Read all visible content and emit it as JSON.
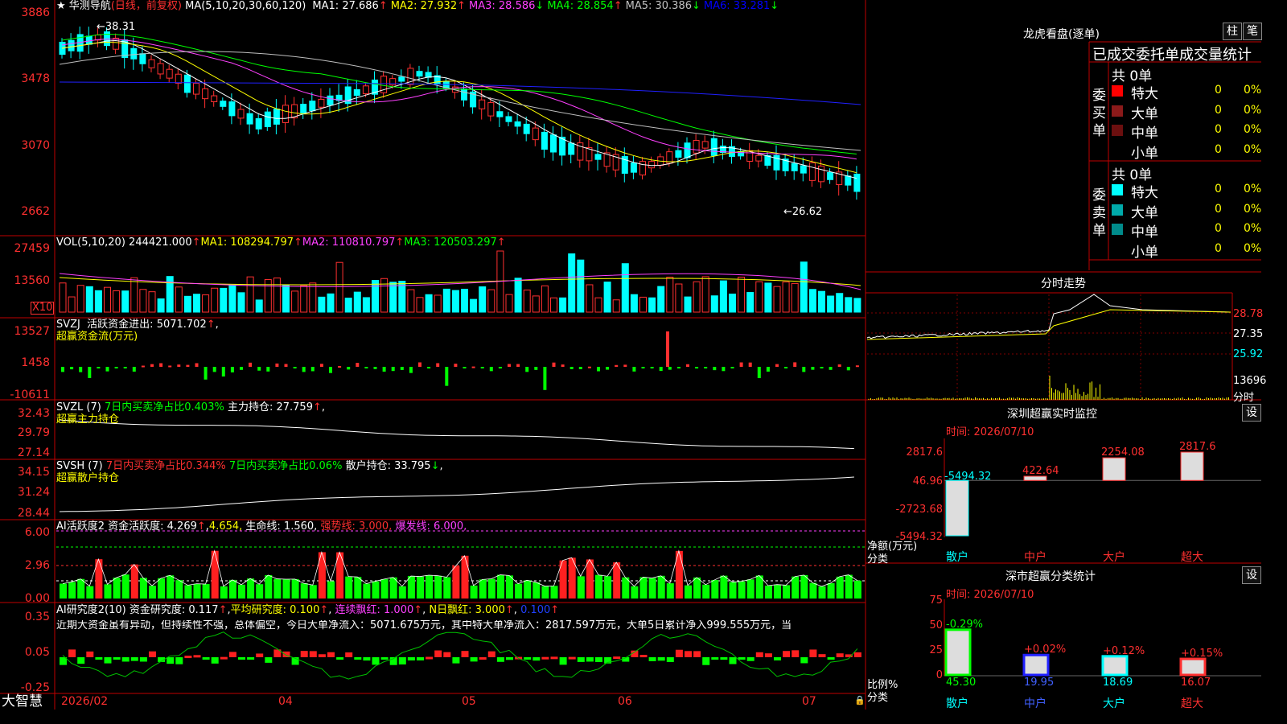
{
  "title": "华测导航",
  "title_suffix": "(日线，前复权)",
  "ma_header": "MA(5,10,20,30,60,120)",
  "ma_values": [
    {
      "label": "MA1:",
      "value": "27.686",
      "arrow": "↑",
      "color": "#ffffff"
    },
    {
      "label": "MA2:",
      "value": "27.932",
      "arrow": "↑",
      "color": "#ffff00"
    },
    {
      "label": "MA3:",
      "value": "28.586",
      "arrow": "↓",
      "color": "#ff40ff"
    },
    {
      "label": "MA4:",
      "value": "28.854",
      "arrow": "↑",
      "color": "#00ff00"
    },
    {
      "label": "MA5:",
      "value": "30.386",
      "arrow": "↓",
      "color": "#c0c0c0"
    },
    {
      "label": "MA6:",
      "value": "33.281",
      "arrow": "↓",
      "color": "#0000ff"
    }
  ],
  "price_axis": [
    "3886",
    "3478",
    "3070",
    "2662"
  ],
  "price_high_label": "38.31",
  "price_low_label": "26.62",
  "vol_header": {
    "name": "VOL(5,10,20)",
    "value": "244421.000",
    "ma1": "MA1: 108294.797",
    "ma2": "MA2: 110810.797",
    "ma3": "MA3: 120503.297"
  },
  "vol_axis": [
    "27459",
    "13560"
  ],
  "vol_unit": "X10",
  "svzj": {
    "name": "SVZJ",
    "label": "活跃资金进出:",
    "value": "5071.702",
    "desc": "超赢资金流(万元)",
    "axis": [
      "13527",
      "1458",
      "-10611"
    ]
  },
  "svzl": {
    "name": "SVZL (7)",
    "t1": "7日内买卖净占比0.403%",
    "t2": "主力持仓: 27.759",
    "desc": "超赢主力持仓",
    "axis": [
      "32.43",
      "29.79",
      "27.14"
    ]
  },
  "svsh": {
    "name": "SVSH (7)",
    "t1": "7日内买卖净占比0.344%",
    "t2": "7日内买卖净占比0.06%",
    "t3": "散户持仓: 33.795",
    "desc": "超赢散户持仓",
    "axis": [
      "34.15",
      "31.24",
      "28.44"
    ]
  },
  "ai1": {
    "name": "AI活跃度2",
    "t1": "资金活跃度: 4.269",
    "t2": "4.654,",
    "t3": "生命线: 1.560,",
    "t4": "强势线: 3.000,",
    "t5": "爆发线: 6.000,",
    "axis": [
      "6.00",
      "2.96",
      "0.00"
    ]
  },
  "ai2": {
    "name": "AI研究度2(10)",
    "t1": "资金研究度: 0.117",
    "t2": "平均研究度: 0.100",
    "t3": "连续飘红: 1.000",
    "t4": "N日飘红: 3.000",
    "t5": "0.100",
    "axis": [
      "0.35",
      "0.05",
      "-0.25"
    ],
    "note": "近期大资金虽有异动，但持续性不强，总体偏空，今日大单净流入：5071.675万元，其中特大单净流入：2817.597万元，大单5日累计净入999.555万元，当"
  },
  "bottom": {
    "brand": "大智慧",
    "dates": [
      "2026/02",
      "04",
      "05",
      "06",
      "07"
    ]
  },
  "dragon": {
    "title": "龙虎看盘(逐单)",
    "btn1": "柱",
    "btn2": "笔",
    "header": "已成交委托单成交量统计",
    "buy_label": "委买单",
    "sell_label": "委卖单",
    "buy_total": "共 0单",
    "sell_total": "共 0单",
    "buy_rows": [
      {
        "name": "特大",
        "n": "0",
        "p": "0%",
        "color": "#ff0000"
      },
      {
        "name": "大单",
        "n": "0",
        "p": "0%",
        "color": "#8b1a1a"
      },
      {
        "name": "中单",
        "n": "0",
        "p": "0%",
        "color": "#6b0f0f"
      },
      {
        "name": "小单",
        "n": "0",
        "p": "0%",
        "color": ""
      }
    ],
    "sell_rows": [
      {
        "name": "特大",
        "n": "0",
        "p": "0%",
        "color": "#00ffff"
      },
      {
        "name": "大单",
        "n": "0",
        "p": "0%",
        "color": "#00aaaa"
      },
      {
        "name": "中单",
        "n": "0",
        "p": "0%",
        "color": "#008b8b"
      },
      {
        "name": "小单",
        "n": "0",
        "p": "0%",
        "color": ""
      }
    ]
  },
  "intraday": {
    "title": "分时走势",
    "axis": [
      "28.78",
      "27.35",
      "25.92",
      "13696"
    ],
    "unit": "分时"
  },
  "monitor": {
    "title": "深圳超赢实时监控",
    "settings": "设",
    "time": "时间: 2026/07/10",
    "axis": [
      "2817.6",
      "46.96",
      "-2723.68",
      "-5494.32"
    ],
    "ylabel": "净额(万元)",
    "xlabel": "分类",
    "categories": [
      "散户",
      "中户",
      "大户",
      "超大"
    ],
    "values": [
      "-5494.32",
      "422.64",
      "2254.08",
      "2817.6"
    ]
  },
  "stats": {
    "title": "深市超赢分类统计",
    "settings": "设",
    "time": "时间: 2026/07/10",
    "axis": [
      "75",
      "50",
      "25",
      "0"
    ],
    "ylabel": "比例%",
    "xlabel": "分类",
    "categories": [
      "散户",
      "中户",
      "大户",
      "超大"
    ],
    "values": [
      "45.30",
      "19.95",
      "18.69",
      "16.07"
    ],
    "changes": [
      "-0.29%",
      "+0.02%",
      "+0.12%",
      "+0.15%"
    ]
  },
  "chart_data": [
    {
      "type": "bar",
      "title": "深圳超赢实时监控",
      "ylabel": "净额(万元)",
      "xlabel": "分类",
      "categories": [
        "散户",
        "中户",
        "大户",
        "超大"
      ],
      "values": [
        -5494.32,
        422.64,
        2254.08,
        2817.6
      ],
      "ylim": [
        -5494.32,
        2817.6
      ]
    },
    {
      "type": "bar",
      "title": "深市超赢分类统计",
      "ylabel": "比例%",
      "xlabel": "分类",
      "categories": [
        "散户",
        "中户",
        "大户",
        "超大"
      ],
      "values": [
        45.3,
        19.95,
        18.69,
        16.07
      ],
      "ylim": [
        0,
        75
      ]
    }
  ]
}
